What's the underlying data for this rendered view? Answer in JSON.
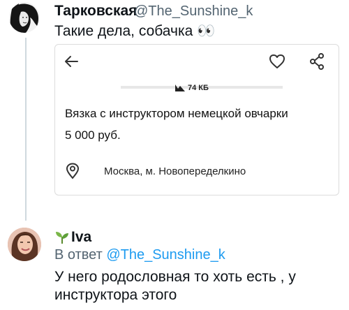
{
  "tweet": {
    "author_name": "Тарковская",
    "author_handle": "@The_Sunshine_k",
    "text": "Такие дела, собачка 👀",
    "card": {
      "file_size": "74 КБ",
      "title": "Вязка с инструктором немецкой овчарки",
      "price": "5 000 руб.",
      "location": "Москва, м. Новопеределкино"
    }
  },
  "reply": {
    "author_name": "Iva",
    "reply_prefix": "В ответ",
    "reply_mention": "@The_Sunshine_k",
    "text_line1": "У него родословная то хоть есть , у",
    "text_line2": "инструктора этого"
  },
  "icons": {
    "back": "arrow-left-icon",
    "favorite": "heart-icon",
    "share": "share-icon",
    "location": "location-pin-icon",
    "plant": "seedling-icon"
  },
  "colors": {
    "mention_blue": "#1d9bf0",
    "secondary_text": "#536471",
    "thread_line": "#cfd9de"
  }
}
